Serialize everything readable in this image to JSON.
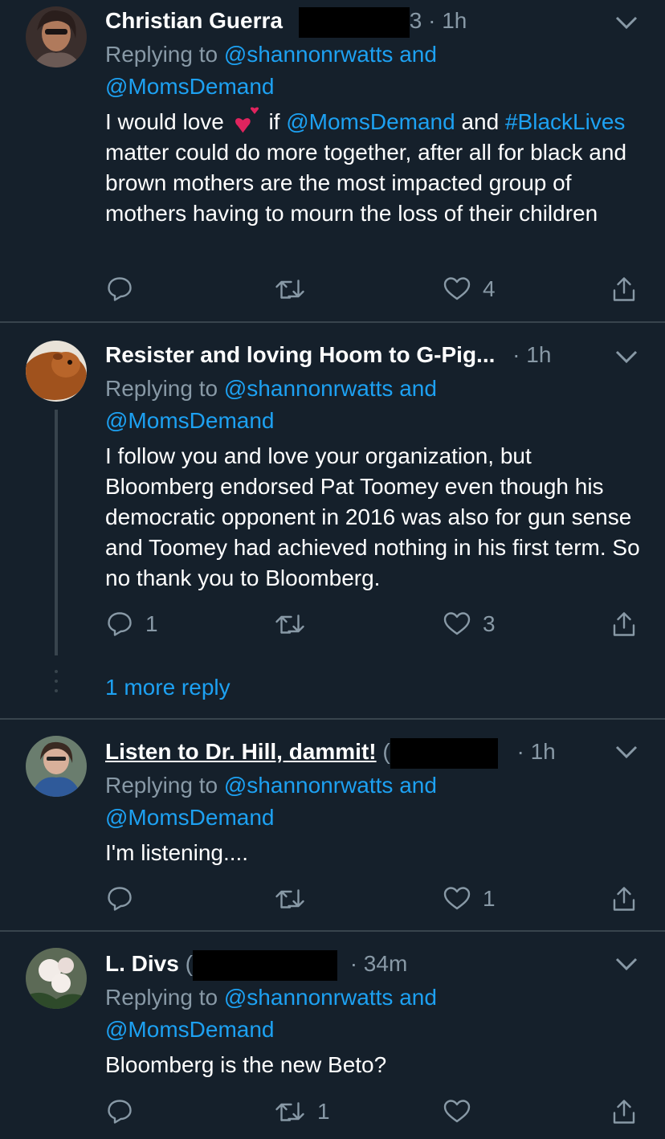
{
  "tweets": [
    {
      "name": "Christian Guerra",
      "handle_tail": "3",
      "time": "· 1h",
      "reply_prefix": "Replying to",
      "reply_handle1": "@shannonrwatts",
      "reply_and": "and",
      "reply_handle2": "@MomsDemand",
      "text_part1": "I would love",
      "text_part2": "if",
      "text_mention": "@MomsDemand",
      "text_part3": "and",
      "text_hashtag": "#BlackLives",
      "text_part4": "matter could do more together, after all for black and brown mothers are the most impacted group of mothers having to mourn the loss of their children",
      "reply_count": "",
      "retweet_count": "",
      "like_count": "4"
    },
    {
      "name": "Resister and loving Hoom to G-Pig...",
      "time": "· 1h",
      "reply_prefix": "Replying to",
      "reply_handle1": "@shannonrwatts",
      "reply_and": "and",
      "reply_handle2": "@MomsDemand",
      "text": "I follow you and love your organization, but Bloomberg endorsed Pat Toomey even though his democratic opponent in 2016 was also for gun sense and Toomey had achieved nothing in his first term. So no thank you to Bloomberg.",
      "reply_count": "1",
      "retweet_count": "",
      "like_count": "3",
      "more_replies": "1 more reply"
    },
    {
      "name": "Listen to Dr. Hill, dammit!",
      "handle_head": "(",
      "time": "· 1h",
      "reply_prefix": "Replying to",
      "reply_handle1": "@shannonrwatts",
      "reply_and": "and",
      "reply_handle2": "@MomsDemand",
      "text": "I'm listening....",
      "reply_count": "",
      "retweet_count": "",
      "like_count": "1"
    },
    {
      "name": "L. Divs",
      "handle_head": "(",
      "time": "· 34m",
      "reply_prefix": "Replying to",
      "reply_handle1": "@shannonrwatts",
      "reply_and": "and",
      "reply_handle2": "@MomsDemand",
      "text": "Bloomberg is the new Beto?",
      "reply_count": "",
      "retweet_count": "1",
      "like_count": ""
    }
  ],
  "colors": {
    "background": "#15202b",
    "link": "#1da1f2",
    "secondary_text": "#8899a6",
    "divider": "#38444d",
    "heart_emoji": "#e0245e"
  },
  "icons": [
    "reply-icon",
    "retweet-icon",
    "like-icon",
    "share-icon",
    "chevron-down-icon",
    "two-hearts-emoji"
  ]
}
